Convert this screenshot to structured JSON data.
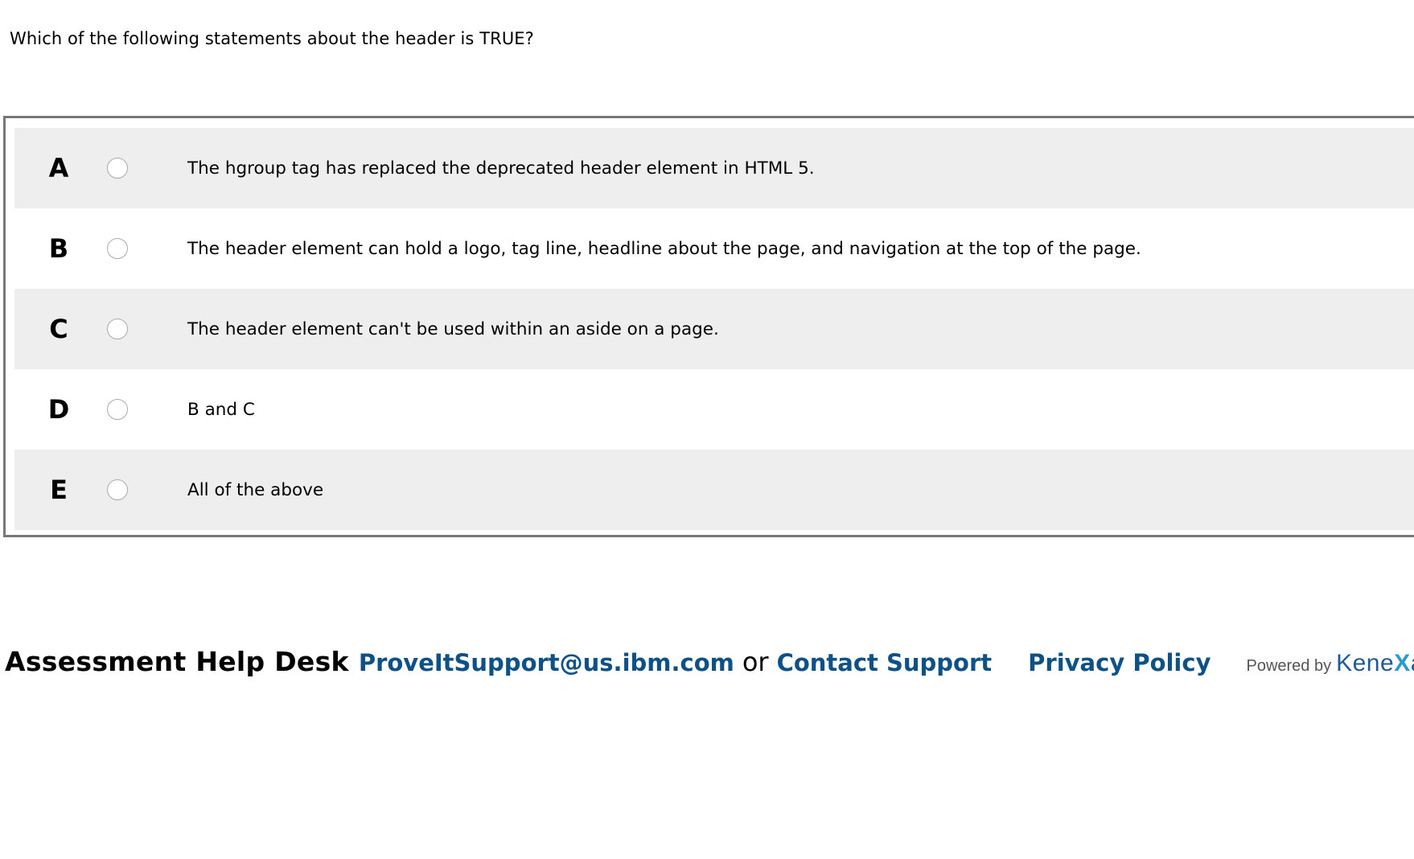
{
  "question": {
    "text": "Which of the following statements about the header is TRUE?"
  },
  "options": [
    {
      "letter": "A",
      "text": "The hgroup tag has replaced the deprecated header element in HTML 5."
    },
    {
      "letter": "B",
      "text": "The header element can hold a logo, tag line, headline about the page, and navigation at the top of the page."
    },
    {
      "letter": "C",
      "text": "The header element can't be used within an aside on a page."
    },
    {
      "letter": "D",
      "text": "B and C"
    },
    {
      "letter": "E",
      "text": "All of the above"
    }
  ],
  "footer": {
    "helpdesk_label": "Assessment Help Desk",
    "email_link": "ProveItSupport@us.ibm.com",
    "or_text": "or",
    "contact_link": "Contact Support",
    "privacy_link": "Privacy Policy",
    "powered_by": "Powered by",
    "brand_part1": "Kene",
    "brand_part2": "X",
    "brand_part3": "a"
  },
  "colors": {
    "link": "#0e5187",
    "row_shade": "#eeeeee",
    "box_border": "#777777"
  }
}
